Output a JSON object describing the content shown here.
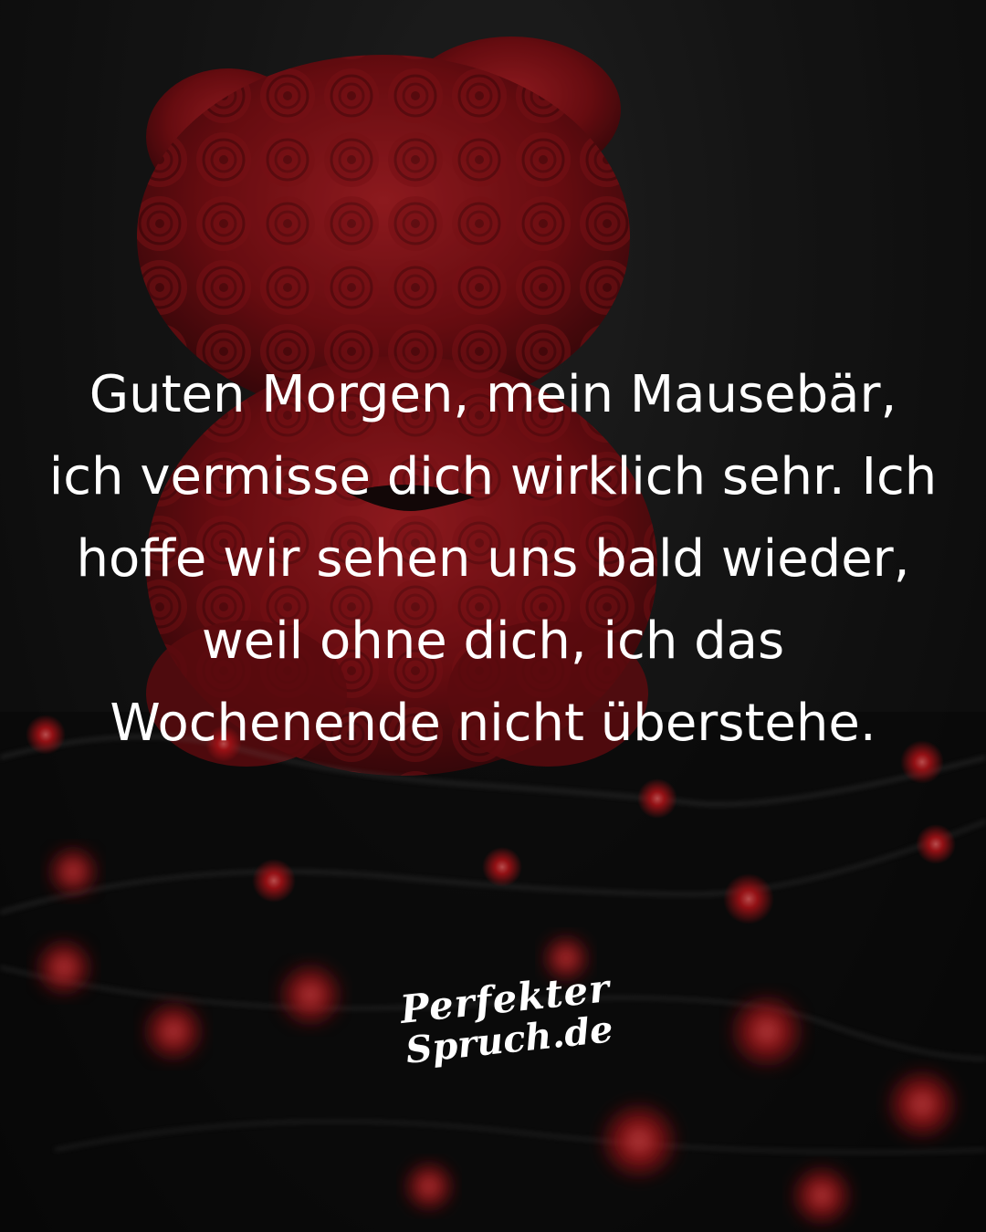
{
  "quote": {
    "lines": [
      "Guten Morgen, mein Mausebär,",
      "ich vermisse dich wirklich sehr. Ich",
      "hoffe wir sehen uns bald wieder,",
      "weil ohne dich, ich das",
      "Wochenende nicht überstehe."
    ]
  },
  "brand": {
    "logo_line1": "Perfekter",
    "logo_line2": "Spruch.de"
  },
  "colors": {
    "background": "#141414",
    "rose_red": "#b0121a",
    "light_red": "#ff3b3b",
    "text": "#ffffff"
  }
}
